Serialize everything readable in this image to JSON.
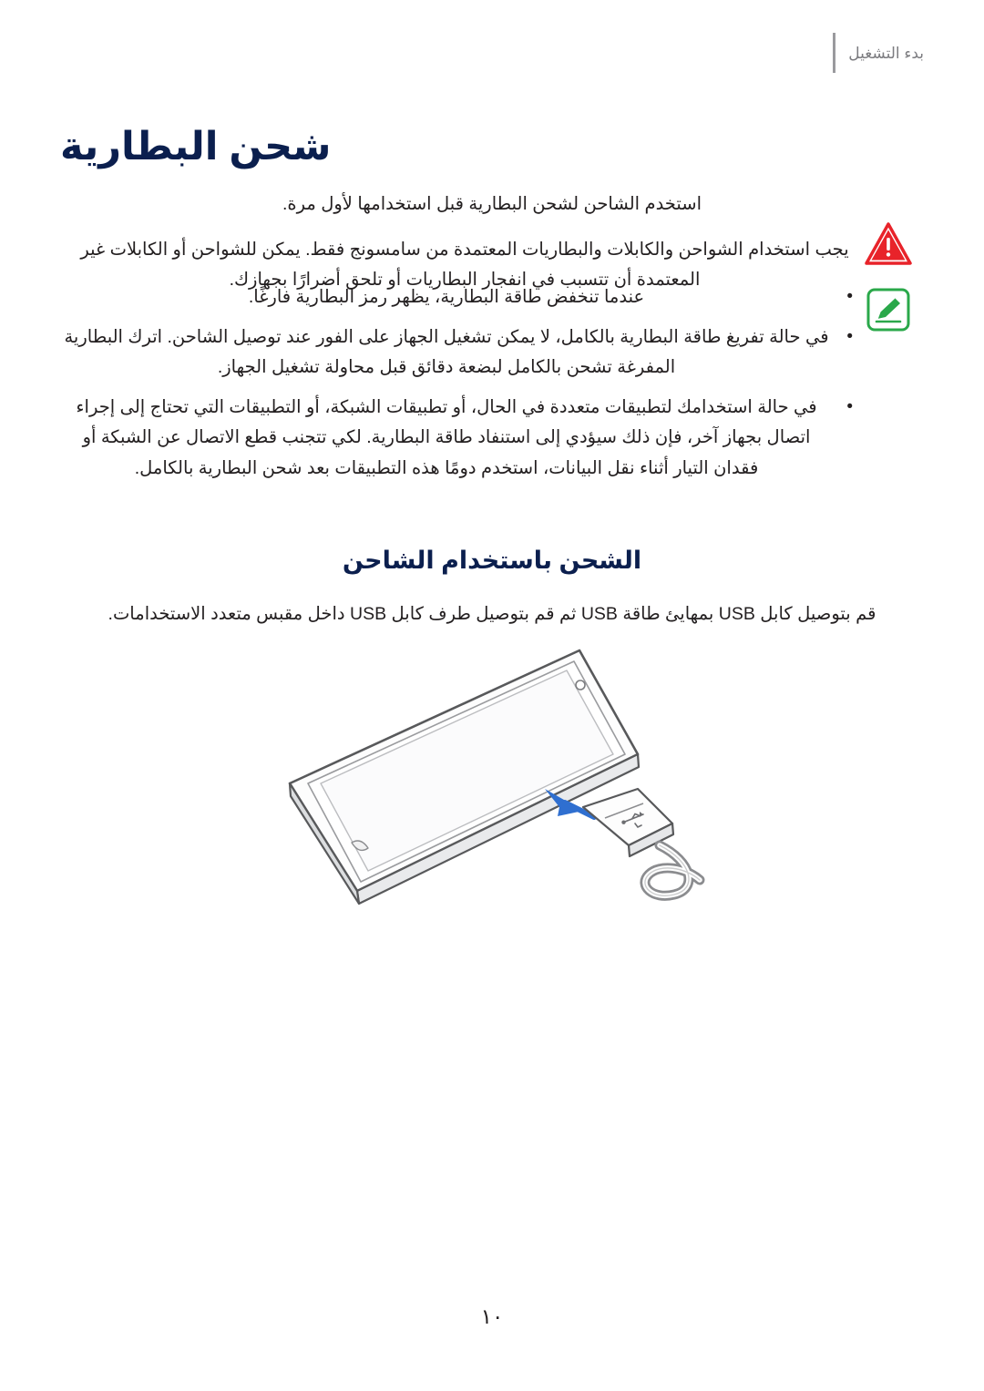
{
  "header": {
    "running_text": "بدء التشغيل"
  },
  "titles": {
    "chapter": "شحن البطارية",
    "section": "الشحن باستخدام الشاحن"
  },
  "body": {
    "intro": "استخدم الشاحن لشحن البطارية قبل استخدامها لأول مرة.",
    "warning": "يجب استخدام الشواحن والكابلات والبطاريات المعتمدة من سامسونج فقط. يمكن للشواحن أو الكابلات غير المعتمدة أن تتسبب في انفجار البطاريات أو تلحق أضرارًا بجهازك.",
    "notes": [
      "عندما تنخفض طاقة البطارية، يظهر رمز البطارية فارغًا.",
      "في حالة تفريغ طاقة البطارية بالكامل، لا يمكن تشغيل الجهاز على الفور عند توصيل الشاحن. اترك البطارية المفرغة تشحن بالكامل لبضعة دقائق قبل محاولة تشغيل الجهاز.",
      "في حالة استخدامك لتطبيقات متعددة في الحال، أو تطبيقات الشبكة، أو التطبيقات التي تحتاج إلى إجراء اتصال بجهاز آخر، فإن ذلك سيؤدي إلى استنفاد طاقة البطارية. لكي تتجنب قطع الاتصال عن الشبكة أو فقدان التيار أثناء نقل البيانات، استخدم دومًا هذه التطبيقات بعد شحن البطارية بالكامل."
    ],
    "usb_instruction": "قم بتوصيل كابل USB بمهايئ طاقة USB ثم قم بتوصيل طرف كابل USB داخل مقبس متعدد الاستخدامات."
  },
  "illustration": {
    "name": "tablet-with-usb-cable-illustration"
  },
  "footer": {
    "page_number": "١٠"
  },
  "colors": {
    "heading": "#0b1f4e",
    "body_text": "#231f20",
    "header_text": "#7c7c80",
    "warning_red": "#e8232a",
    "note_green": "#2aa84a"
  }
}
